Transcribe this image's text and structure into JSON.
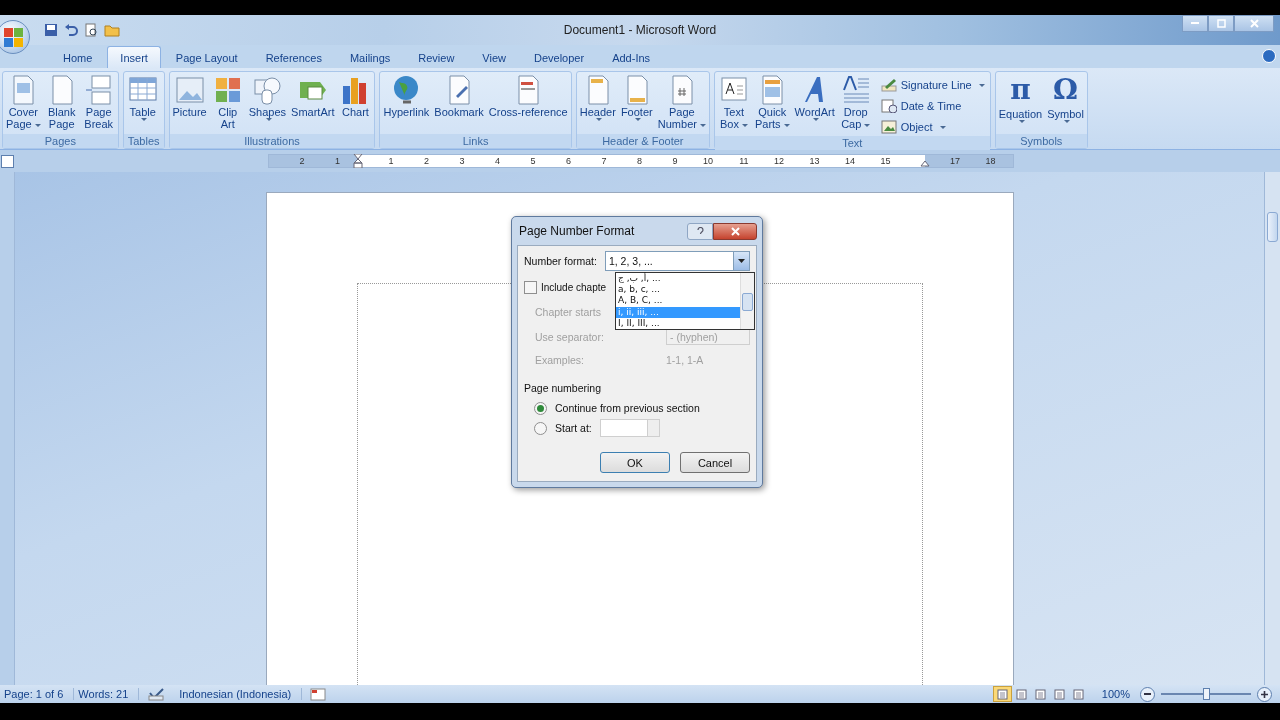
{
  "window": {
    "title": "Document1 - Microsoft Word"
  },
  "tabs": [
    {
      "label": "Home",
      "selected": false
    },
    {
      "label": "Insert",
      "selected": true
    },
    {
      "label": "Page Layout",
      "selected": false
    },
    {
      "label": "References",
      "selected": false
    },
    {
      "label": "Mailings",
      "selected": false
    },
    {
      "label": "Review",
      "selected": false
    },
    {
      "label": "View",
      "selected": false
    },
    {
      "label": "Developer",
      "selected": false
    },
    {
      "label": "Add-Ins",
      "selected": false
    }
  ],
  "ribbon_groups": [
    {
      "label": "Pages",
      "buttons": [
        {
          "kind": "cover",
          "lines": [
            "Cover",
            "Page"
          ],
          "dropdown": true
        },
        {
          "kind": "page",
          "lines": [
            "Blank",
            "Page"
          ],
          "dropdown": false
        },
        {
          "kind": "break",
          "lines": [
            "Page",
            "Break"
          ],
          "dropdown": false
        }
      ]
    },
    {
      "label": "Tables",
      "buttons": [
        {
          "kind": "table",
          "lines": [
            "Table"
          ],
          "dropdown": true
        }
      ]
    },
    {
      "label": "Illustrations",
      "buttons": [
        {
          "kind": "picture",
          "lines": [
            "Picture"
          ],
          "dropdown": false
        },
        {
          "kind": "clipart",
          "lines": [
            "Clip",
            "Art"
          ],
          "dropdown": false
        },
        {
          "kind": "shapes",
          "lines": [
            "Shapes"
          ],
          "dropdown": true
        },
        {
          "kind": "smartart",
          "lines": [
            "SmartArt"
          ],
          "dropdown": false
        },
        {
          "kind": "chart",
          "lines": [
            "Chart"
          ],
          "dropdown": false
        }
      ]
    },
    {
      "label": "Links",
      "buttons": [
        {
          "kind": "globe",
          "lines": [
            "Hyperlink"
          ],
          "dropdown": false
        },
        {
          "kind": "bookmark",
          "lines": [
            "Bookmark"
          ],
          "dropdown": false
        },
        {
          "kind": "crossref",
          "lines": [
            "Cross-reference"
          ],
          "dropdown": false
        }
      ]
    },
    {
      "label": "Header & Footer",
      "buttons": [
        {
          "kind": "header",
          "lines": [
            "Header"
          ],
          "dropdown": true
        },
        {
          "kind": "footer",
          "lines": [
            "Footer"
          ],
          "dropdown": true
        },
        {
          "kind": "pagenum",
          "lines": [
            "Page",
            "Number"
          ],
          "dropdown": true
        }
      ]
    },
    {
      "label": "Text",
      "buttons": [
        {
          "kind": "textbox",
          "lines": [
            "Text",
            "Box"
          ],
          "dropdown": true
        },
        {
          "kind": "quickparts",
          "lines": [
            "Quick",
            "Parts"
          ],
          "dropdown": true
        },
        {
          "kind": "wordart",
          "lines": [
            "WordArt"
          ],
          "dropdown": true
        },
        {
          "kind": "dropcap",
          "lines": [
            "Drop",
            "Cap"
          ],
          "dropdown": true
        }
      ],
      "small_buttons": [
        {
          "kind": "signature",
          "label": "Signature Line",
          "dropdown": true
        },
        {
          "kind": "datetime",
          "label": "Date & Time",
          "dropdown": false
        },
        {
          "kind": "object",
          "label": "Object",
          "dropdown": true
        }
      ]
    },
    {
      "label": "Symbols",
      "buttons": [
        {
          "kind": "glyph",
          "glyph": "π",
          "lines": [
            "Equation"
          ],
          "dropdown": true
        },
        {
          "kind": "glyph",
          "glyph": "Ω",
          "lines": [
            "Symbol"
          ],
          "dropdown": true
        }
      ]
    }
  ],
  "ruler": {
    "left_numbers": [
      "2",
      "1"
    ],
    "numbers": [
      "1",
      "2",
      "3",
      "4",
      "5",
      "6",
      "7",
      "8",
      "9",
      "10",
      "11",
      "12",
      "13",
      "14",
      "15"
    ],
    "right_numbers": [
      "17",
      "18"
    ]
  },
  "dialog": {
    "title": "Page Number Format",
    "number_format": {
      "label": "Number format:",
      "value": "1, 2, 3, ...",
      "open": true
    },
    "format_list": [
      {
        "label": "أ, ب, ج, ...",
        "selected": false
      },
      {
        "label": "a, b, c, ...",
        "selected": false
      },
      {
        "label": "A, B, C, ...",
        "selected": false
      },
      {
        "label": "i, ii, iii, ...",
        "selected": true
      },
      {
        "label": "I, II, III, ...",
        "selected": false
      }
    ],
    "include_chapter": {
      "label": "Include chapte",
      "checked": false
    },
    "chapter_starts": {
      "label": "Chapter starts",
      "disabled": true
    },
    "use_separator": {
      "label": "Use separator:",
      "value": "-  (hyphen)",
      "disabled": true
    },
    "examples": {
      "label": "Examples:",
      "value": "1-1, 1-A",
      "disabled": true
    },
    "page_numbering": {
      "label": "Page numbering",
      "options": [
        {
          "label": "Continue from previous section",
          "selected": true
        },
        {
          "label": "Start at:",
          "selected": false
        }
      ]
    },
    "buttons": [
      "OK",
      "Cancel"
    ]
  },
  "status_bar": {
    "page": "Page: 1 of 6",
    "words": "Words: 21",
    "language": "Indonesian (Indonesia)",
    "views": [
      {
        "selected": true
      },
      {
        "selected": false
      },
      {
        "selected": false
      },
      {
        "selected": false
      },
      {
        "selected": false
      }
    ],
    "zoom": "100%",
    "zoom_slider": {
      "level": 0.5
    }
  }
}
